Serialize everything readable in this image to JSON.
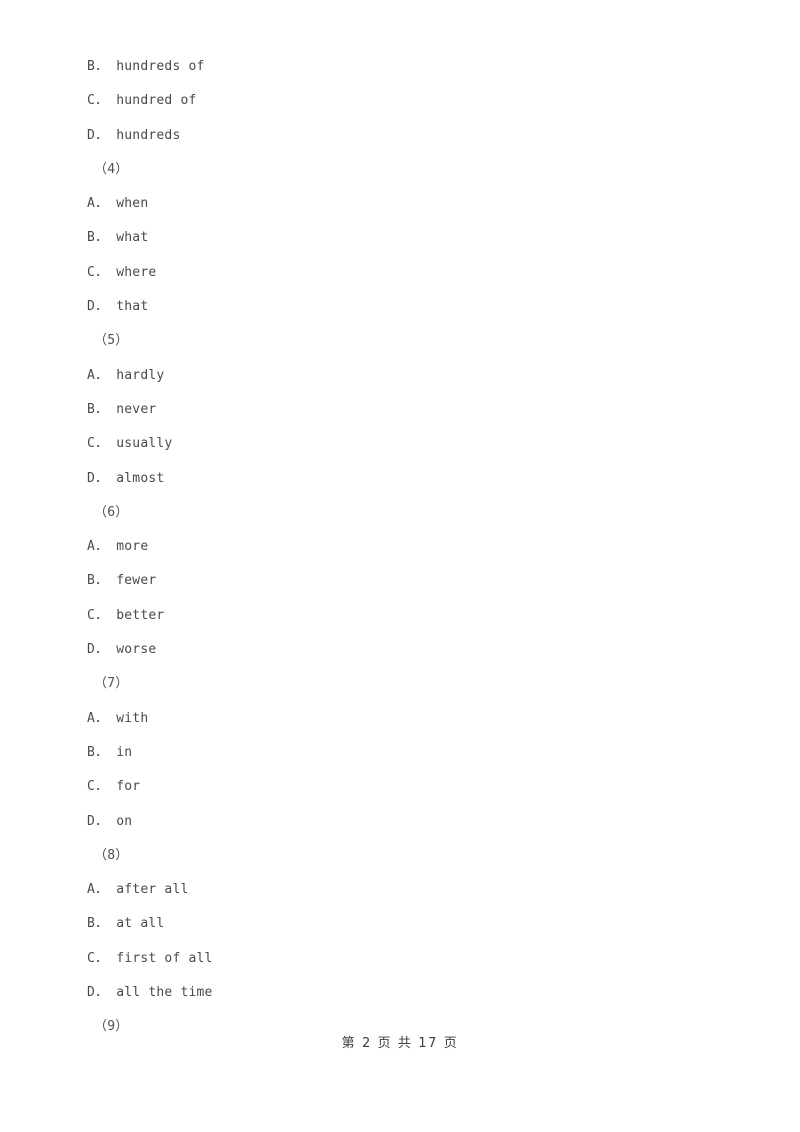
{
  "document": {
    "page_background": "#ffffff",
    "text_color": "#4a4a4a",
    "lines": [
      {
        "kind": "option",
        "text": "B． hundreds of"
      },
      {
        "kind": "option",
        "text": "C． hundred of"
      },
      {
        "kind": "option",
        "text": "D． hundreds"
      },
      {
        "kind": "qnum",
        "text": "（4）"
      },
      {
        "kind": "option",
        "text": "A． when"
      },
      {
        "kind": "option",
        "text": "B． what"
      },
      {
        "kind": "option",
        "text": "C． where"
      },
      {
        "kind": "option",
        "text": "D． that"
      },
      {
        "kind": "qnum",
        "text": "（5）"
      },
      {
        "kind": "option",
        "text": "A． hardly"
      },
      {
        "kind": "option",
        "text": "B． never"
      },
      {
        "kind": "option",
        "text": "C． usually"
      },
      {
        "kind": "option",
        "text": "D． almost"
      },
      {
        "kind": "qnum",
        "text": "（6）"
      },
      {
        "kind": "option",
        "text": "A． more"
      },
      {
        "kind": "option",
        "text": "B． fewer"
      },
      {
        "kind": "option",
        "text": "C． better"
      },
      {
        "kind": "option",
        "text": "D． worse"
      },
      {
        "kind": "qnum",
        "text": "（7）"
      },
      {
        "kind": "option",
        "text": "A． with"
      },
      {
        "kind": "option",
        "text": "B． in"
      },
      {
        "kind": "option",
        "text": "C． for"
      },
      {
        "kind": "option",
        "text": "D． on"
      },
      {
        "kind": "qnum",
        "text": "（8）"
      },
      {
        "kind": "option",
        "text": "A． after all"
      },
      {
        "kind": "option",
        "text": "B． at all"
      },
      {
        "kind": "option",
        "text": "C． first of all"
      },
      {
        "kind": "option",
        "text": "D． all the time"
      },
      {
        "kind": "qnum",
        "text": "（9）"
      }
    ]
  },
  "footer": {
    "page_label": "第 2 页 共 17 页",
    "current_page": "2",
    "total_pages": "17"
  }
}
